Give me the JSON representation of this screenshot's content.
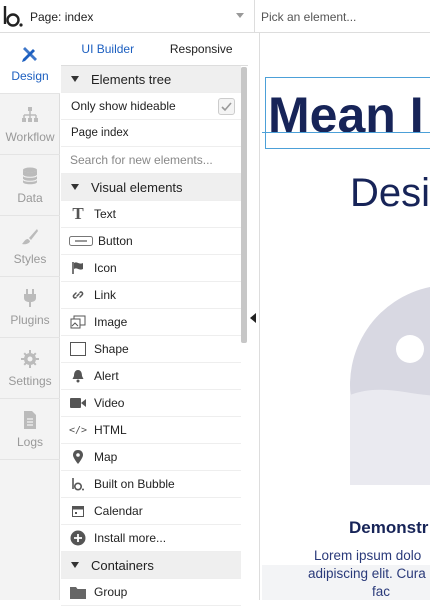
{
  "topbar": {
    "logo_name": "bubble-logo",
    "page_select": "Page: index",
    "element_picker_placeholder": "Pick an element..."
  },
  "nav": [
    {
      "label": "Design",
      "icon": "pencil-ruler-icon",
      "active": true
    },
    {
      "label": "Workflow",
      "icon": "workflow-icon"
    },
    {
      "label": "Data",
      "icon": "database-icon"
    },
    {
      "label": "Styles",
      "icon": "brush-icon"
    },
    {
      "label": "Plugins",
      "icon": "plug-icon"
    },
    {
      "label": "Settings",
      "icon": "gear-icon"
    },
    {
      "label": "Logs",
      "icon": "document-icon"
    }
  ],
  "panel": {
    "tabs": [
      "UI Builder",
      "Responsive"
    ],
    "elements_tree_label": "Elements tree",
    "only_show_hideable": "Only show hideable",
    "page_index": "Page index",
    "search_placeholder": "Search for new elements...",
    "visual_elements_label": "Visual elements",
    "visual_items": [
      {
        "label": "Text",
        "icon": "text-icon"
      },
      {
        "label": "Button",
        "icon": "button-icon"
      },
      {
        "label": "Icon",
        "icon": "flag-icon"
      },
      {
        "label": "Link",
        "icon": "link-icon"
      },
      {
        "label": "Image",
        "icon": "image-icon"
      },
      {
        "label": "Shape",
        "icon": "shape-icon"
      },
      {
        "label": "Alert",
        "icon": "bell-icon"
      },
      {
        "label": "Video",
        "icon": "video-icon"
      },
      {
        "label": "HTML",
        "icon": "code-icon"
      },
      {
        "label": "Map",
        "icon": "map-pin-icon"
      },
      {
        "label": "Built on Bubble",
        "icon": "bubble-logo-icon"
      },
      {
        "label": "Calendar",
        "icon": "calendar-icon"
      },
      {
        "label": "Install more...",
        "icon": "plus-circle-icon"
      }
    ],
    "containers_label": "Containers",
    "container_items": [
      {
        "label": "Group",
        "icon": "folder-icon"
      }
    ]
  },
  "canvas": {
    "hero_title": "Mean I",
    "sub_title": "Desi",
    "demo_heading": "Demonstr",
    "lorem_lines": [
      "Lorem ipsum dolo",
      "adipiscing elit. Cura",
      "fac"
    ]
  },
  "colors": {
    "accent": "#1c5fc0",
    "canvas_text": "#172458",
    "selection": "#4ca0d8"
  }
}
